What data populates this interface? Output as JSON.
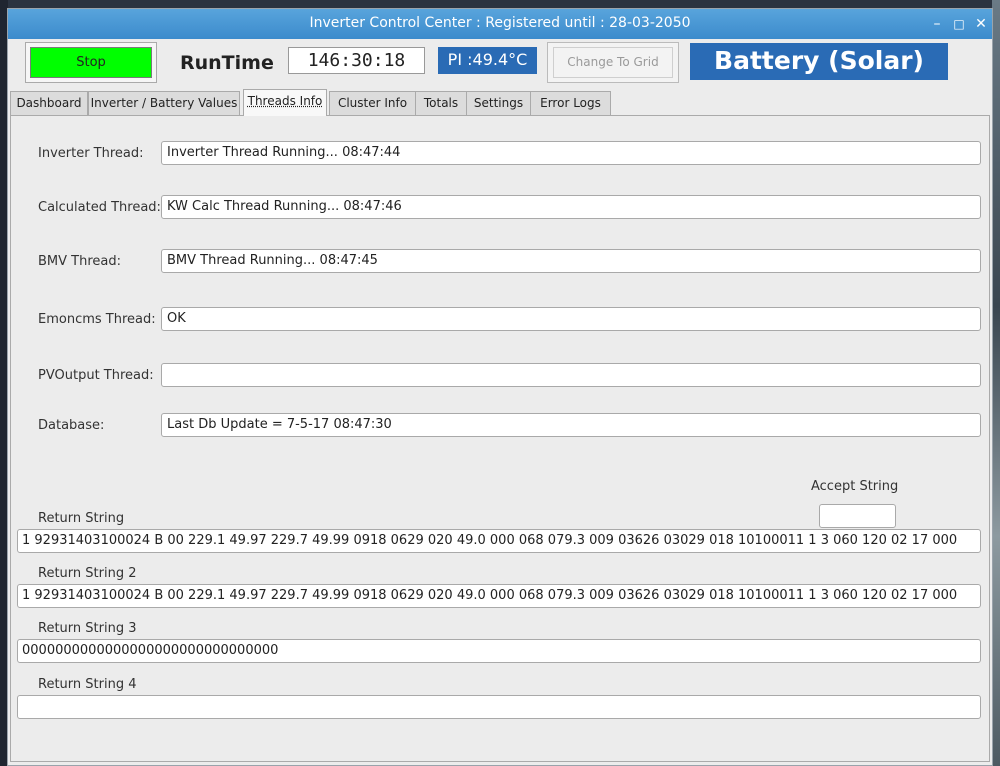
{
  "window": {
    "title": "Inverter Control Center : Registered until : 28-03-2050",
    "minimize": "–",
    "maximize": "□",
    "close": "✕"
  },
  "header": {
    "stop_label": "Stop",
    "runtime_label": "RunTime",
    "runtime_value": "146:30:18",
    "pi_temp": "PI :49.4°C",
    "change_grid_label": "Change To Grid",
    "mode": "Battery (Solar)"
  },
  "colors": {
    "stop": "#00ff00",
    "badge": "#2a6bb5",
    "titlebar": "#4a97d5"
  },
  "tabs": [
    {
      "label": "Dashboard"
    },
    {
      "label": "Inverter / Battery Values"
    },
    {
      "label": "Threads Info"
    },
    {
      "label": "Cluster Info"
    },
    {
      "label": "Totals"
    },
    {
      "label": "Settings"
    },
    {
      "label": "Error Logs"
    }
  ],
  "threads": {
    "inverter": {
      "label": "Inverter Thread:",
      "value": "Inverter Thread Running...   08:47:44"
    },
    "calculated": {
      "label": "Calculated Thread:",
      "value": "KW Calc Thread Running...   08:47:46"
    },
    "bmv": {
      "label": "BMV Thread:",
      "value": "BMV Thread Running...   08:47:45"
    },
    "emoncms": {
      "label": "Emoncms Thread:",
      "value": "OK"
    },
    "pvoutput": {
      "label": "PVOutput Thread:",
      "value": ""
    },
    "database": {
      "label": "Database:",
      "value": "Last Db Update = 7-5-17 08:47:30"
    }
  },
  "accept_string_label": "Accept String",
  "return_strings": [
    {
      "label": "Return String",
      "value": "1 92931403100024 B 00 229.1 49.97 229.7 49.99 0918 0629 020 49.0 000 068 079.3 009 03626 03029 018 10100011 1 3 060 120 02 17 000"
    },
    {
      "label": "Return String 2",
      "value": "1 92931403100024 B 00 229.1 49.97 229.7 49.99 0918 0629 020 49.0 000 068 079.3 009 03626 03029 018 10100011 1 3 060 120 02 17 000"
    },
    {
      "label": "Return String 3",
      "value": "0000000000000000000000000000000"
    },
    {
      "label": "Return String 4",
      "value": ""
    }
  ]
}
